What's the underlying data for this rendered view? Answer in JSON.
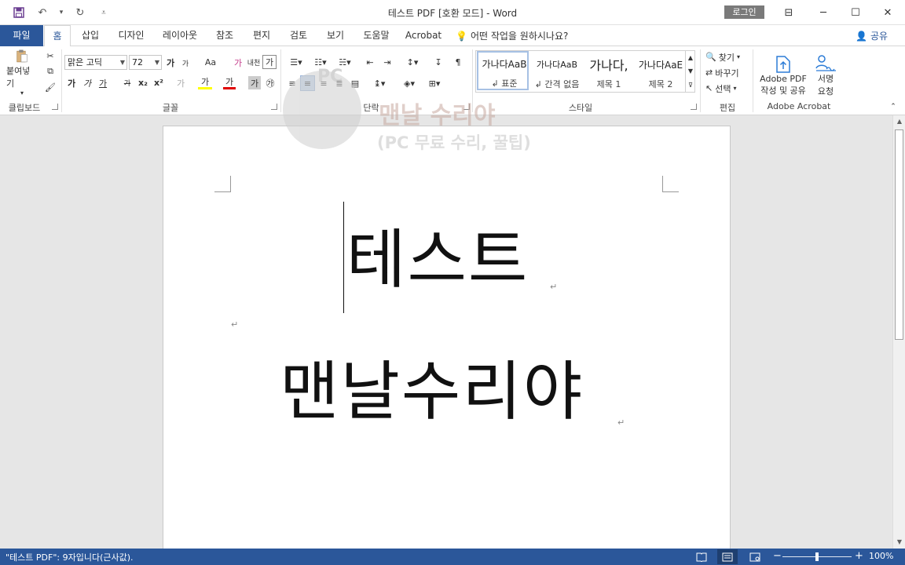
{
  "window": {
    "title": "테스트 PDF [호환 모드]  -  Word",
    "login": "로그인",
    "minimize": "─",
    "maximize": "☐",
    "close": "✕",
    "restore_ribbon": "⊟"
  },
  "qat": {
    "save": "💾",
    "undo": "↶",
    "undo_arrow": "▾",
    "redo": "↻",
    "customize": "⩡"
  },
  "tabs": [
    {
      "label": "파일"
    },
    {
      "label": "홈"
    },
    {
      "label": "삽입"
    },
    {
      "label": "디자인"
    },
    {
      "label": "레이아웃"
    },
    {
      "label": "참조"
    },
    {
      "label": "편지"
    },
    {
      "label": "검토"
    },
    {
      "label": "보기"
    },
    {
      "label": "도움말"
    },
    {
      "label": "Acrobat"
    }
  ],
  "tell_me": "어떤 작업을 원하시나요?",
  "share": "공유",
  "ribbon": {
    "clipboard": {
      "label": "클립보드",
      "paste": "붙여넣기"
    },
    "font": {
      "label": "글꼴",
      "font_name": "맑은 고딕",
      "font_size": "72",
      "bold": "가",
      "italic": "가",
      "underline": "가",
      "strike": "가",
      "sub": "x₂",
      "sup": "x²",
      "grow": "가",
      "shrink": "가",
      "case": "Aa",
      "clear": "가",
      "phonetic": "내천",
      "border": "가",
      "highlight": "가",
      "color": "가",
      "shade": "가",
      "enclose": "㉮",
      "effect": "가"
    },
    "paragraph": {
      "label": "단락"
    },
    "styles": {
      "label": "스타일",
      "items": [
        {
          "preview": "가나다AaB",
          "name": "↲ 표준"
        },
        {
          "preview": "가나다AaB",
          "name": "↲ 간격 없음"
        },
        {
          "preview": "가나다,",
          "name": "제목 1"
        },
        {
          "preview": "가나다AaE",
          "name": "제목 2"
        }
      ]
    },
    "editing": {
      "label": "편집",
      "find": "찾기",
      "replace": "바꾸기",
      "select": "선택"
    },
    "acrobat": {
      "label": "Adobe Acrobat",
      "create_line1": "Adobe PDF",
      "create_line2": "작성 및 공유",
      "sign_line1": "서명",
      "sign_line2": "요청"
    }
  },
  "document": {
    "line1": "테스트",
    "line2": "맨날수리야",
    "pilcrow": "↵"
  },
  "watermark": {
    "top": "PC",
    "main": "맨날 수리야",
    "sub": "(PC 무료 수리, 꿀팁)"
  },
  "status": {
    "text": "\"테스트 PDF\": 9자입니다(근사값).",
    "zoom": "100%",
    "zoom_value_percent": 100
  }
}
